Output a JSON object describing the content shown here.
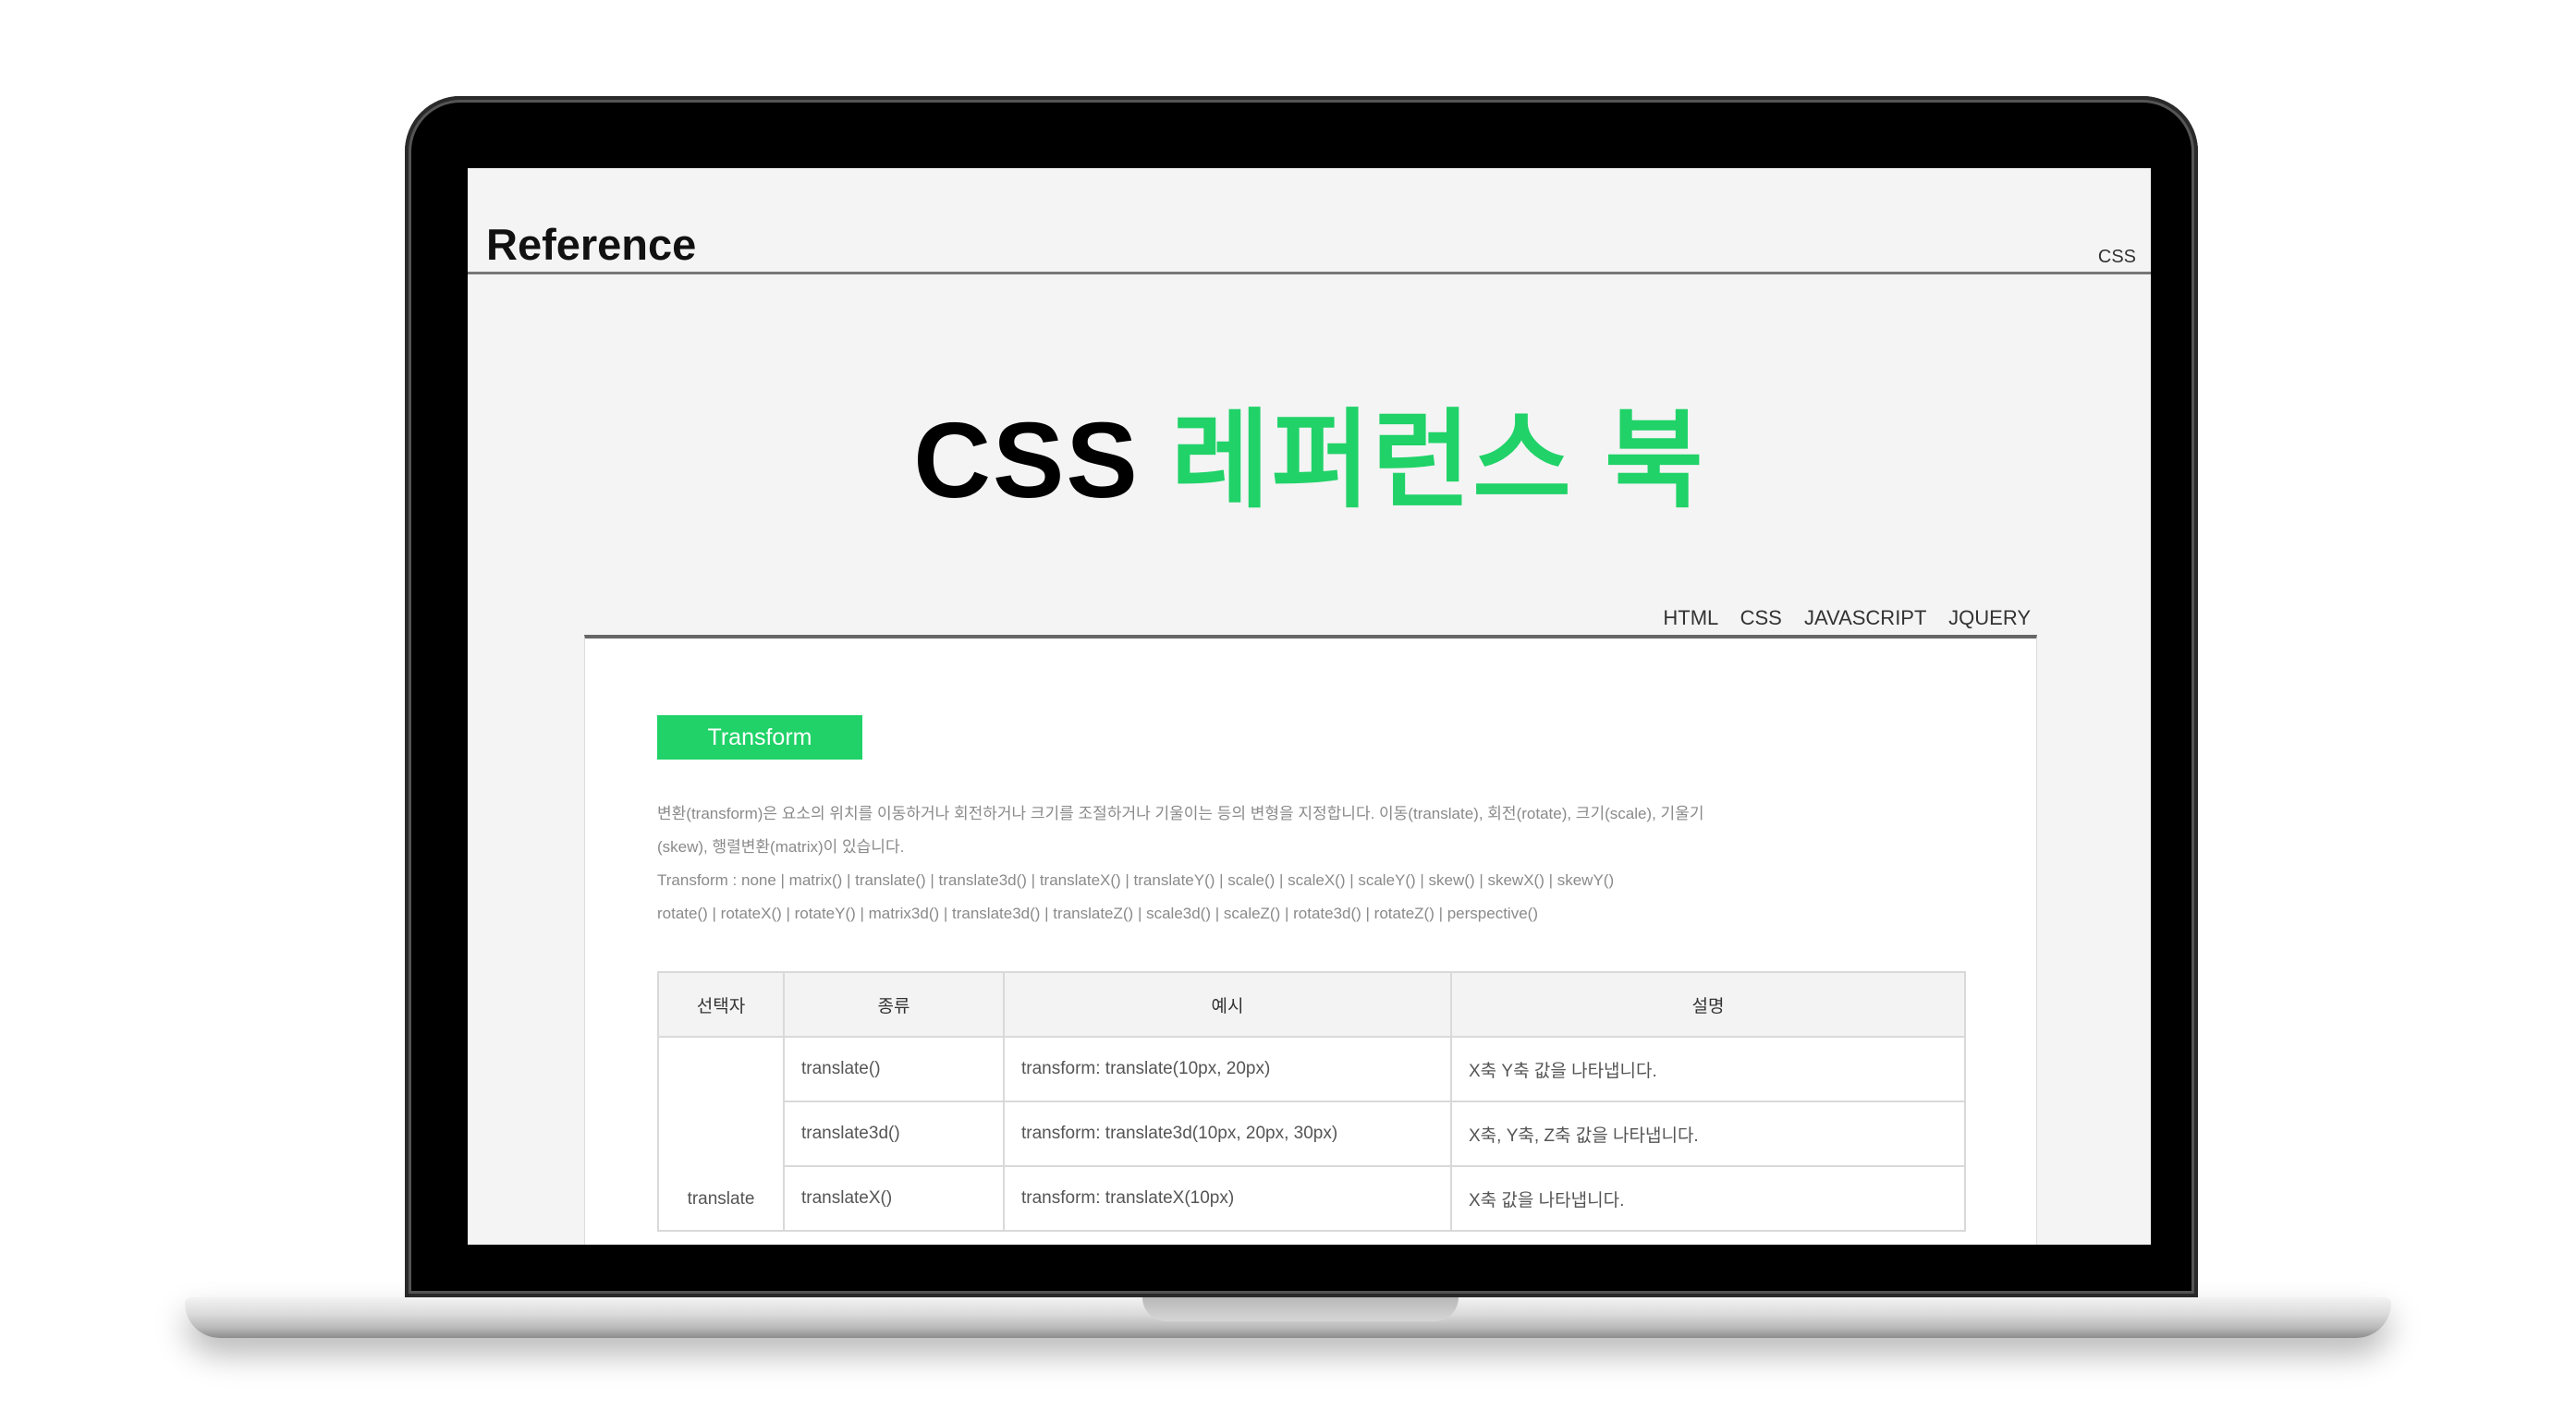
{
  "site": {
    "logo": "Reference",
    "header_link": "CSS"
  },
  "hero": {
    "title_part1": "CSS",
    "title_part2": "레퍼런스 북"
  },
  "nav": [
    "HTML",
    "CSS",
    "JAVASCRIPT",
    "JQUERY"
  ],
  "section": {
    "badge": "Transform",
    "description": [
      "변환(transform)은 요소의 위치를 이동하거나 회전하거나 크기를 조절하거나 기울이는 등의 변형을 지정합니다. 이동(translate), 회전(rotate), 크기(scale), 기울기",
      "(skew), 행렬변환(matrix)이 있습니다.",
      "Transform : none | matrix() | translate() | translate3d() | translateX() | translateY() | scale() | scaleX() | scaleY() | skew() | skewX() | skewY()",
      "rotate() | rotateX() | rotateY() | matrix3d() | translate3d() | translateZ() | scale3d() | scaleZ() | rotate3d() | rotateZ() | perspective()"
    ],
    "table": {
      "headers": [
        "선택자",
        "종류",
        "예시",
        "설명"
      ],
      "group": "translate",
      "rows": [
        [
          "translate()",
          "transform: translate(10px, 20px)",
          "X축 Y축 값을 나타냅니다."
        ],
        [
          "translate3d()",
          "transform: translate3d(10px, 20px, 30px)",
          "X축, Y축, Z축 값을 나타냅니다."
        ],
        [
          "translateX()",
          "transform: translateX(10px)",
          "X축 값을 나타냅니다."
        ]
      ]
    }
  }
}
